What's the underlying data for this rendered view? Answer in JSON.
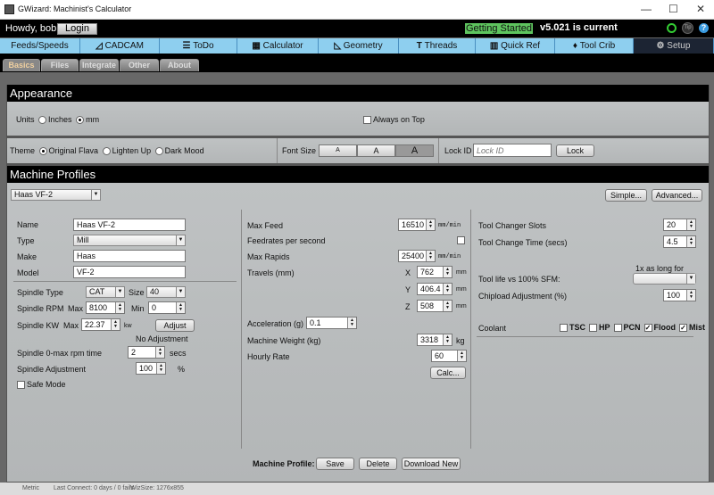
{
  "window": {
    "title": "GWizard: Machinist's Calculator",
    "minimize": "—",
    "maximize": "☐",
    "close": "✕"
  },
  "header": {
    "greeting": "Howdy, bob!",
    "login": "Login",
    "getting_started": "Getting Started",
    "version": "v5.021 is current",
    "icons": [
      "refresh-icon",
      "tip-icon",
      "help-icon"
    ]
  },
  "nav": [
    {
      "label": "Feeds/Speeds",
      "icon": ""
    },
    {
      "label": "CADCAM",
      "icon": "◿"
    },
    {
      "label": "ToDo",
      "icon": "☰"
    },
    {
      "label": "Calculator",
      "icon": "▦"
    },
    {
      "label": "Geometry",
      "icon": "◺"
    },
    {
      "label": "Threads",
      "icon": "T"
    },
    {
      "label": "Quick Ref",
      "icon": "▥"
    },
    {
      "label": "Tool Crib",
      "icon": "♦"
    },
    {
      "label": "Setup",
      "icon": "⚙"
    }
  ],
  "subtabs": [
    "Basics",
    "Files",
    "Integrate",
    "Other",
    "About"
  ],
  "appearance": {
    "title": "Appearance",
    "units_label": "Units",
    "inches": "Inches",
    "mm": "mm",
    "units_selected": "mm",
    "always_on_top": "Always on Top",
    "theme_label": "Theme",
    "themes": [
      "Original Flava",
      "Lighten Up",
      "Dark Mood"
    ],
    "theme_selected": "Original Flava",
    "font_size_label": "Font Size",
    "font_sizes": [
      "A",
      "A",
      "A"
    ],
    "lock_id_label": "Lock ID",
    "lock_id_placeholder": "Lock ID",
    "lock_button": "Lock"
  },
  "profiles": {
    "title": "Machine Profiles",
    "selected": "Haas VF-2",
    "simple": "Simple...",
    "advanced": "Advanced...",
    "name_label": "Name",
    "name": "Haas VF-2",
    "type_label": "Type",
    "type": "Mill",
    "make_label": "Make",
    "make": "Haas",
    "model_label": "Model",
    "model": "VF-2",
    "spindle_type_label": "Spindle Type",
    "spindle_type": "CAT",
    "size_label": "Size",
    "size": "40",
    "rpm_label": "Spindle RPM",
    "max_label": "Max",
    "rpm_max": "8100",
    "min_label": "Min",
    "rpm_min": "0",
    "kw_label": "Spindle KW",
    "kw_max": "22.37",
    "kw_unit": "kw",
    "adjust": "Adjust",
    "no_adjust": "No Adjustment",
    "rpm_time_label": "Spindle 0-max rpm time",
    "rpm_time": "2",
    "secs": "secs",
    "spindle_adj_label": "Spindle Adjustment",
    "spindle_adj": "100",
    "pct": "%",
    "safe_mode": "Safe Mode",
    "max_feed_label": "Max Feed",
    "max_feed": "16510",
    "mmmin": "mm/min",
    "feed_per_sec": "Feedrates per second",
    "max_rapids_label": "Max Rapids",
    "max_rapids": "25400",
    "travels_label": "Travels (mm)",
    "x": "X",
    "y": "Y",
    "z": "Z",
    "tx": "762",
    "ty": "406.4",
    "tz": "508",
    "mm": "mm",
    "accel_label": "Acceleration (g)",
    "accel": "0.1",
    "weight_label": "Machine Weight (kg)",
    "weight": "3318",
    "kg": "kg",
    "rate_label": "Hourly Rate",
    "rate": "60",
    "calc": "Calc...",
    "slots_label": "Tool Changer Slots",
    "slots": "20",
    "change_time_label": "Tool Change Time (secs)",
    "change_time": "4.5",
    "tool_life_label": "Tool life vs 100% SFM:",
    "tool_life_caption": "1x as long for",
    "tool_life": "",
    "chipload_label": "Chipload Adjustment (%)",
    "chipload": "100",
    "coolant_label": "Coolant",
    "coolants": [
      {
        "label": "TSC",
        "checked": false
      },
      {
        "label": "HP",
        "checked": false
      },
      {
        "label": "PCN",
        "checked": false
      },
      {
        "label": "Flood",
        "checked": true
      },
      {
        "label": "Mist",
        "checked": true
      }
    ],
    "footer_label": "Machine Profile:",
    "save": "Save",
    "delete": "Delete",
    "download": "Download New"
  },
  "status": {
    "units": "Metric",
    "last_connect": "Last Connect: 0 days / 0 fails",
    "wizsize": "WizSize: 1276x855"
  }
}
